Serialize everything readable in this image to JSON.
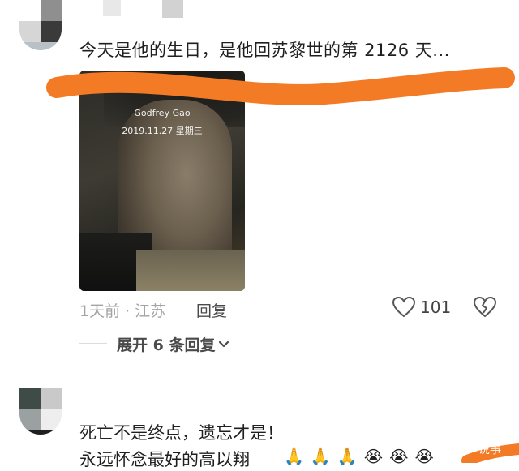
{
  "comment1": {
    "text": "今天是他的生日，是他回苏黎世的第 2126 天...",
    "photo": {
      "name": "Godfrey Gao",
      "date": "2019.11.27  星期三"
    },
    "time_location": "1天前 · 江苏",
    "reply_label": "回复",
    "like_count": "101",
    "expand_replies": "展开 6 条回复"
  },
  "comment2": {
    "line1": "死亡不是终点，遗忘才是！",
    "line2": "永远怀念最好的高以翔",
    "emoji": "🙏🙏🙏😭😭😭"
  },
  "watermark": "说事",
  "icons": {
    "like": "heart-outline-icon",
    "dislike": "broken-heart-icon",
    "expand": "chevron-down-icon"
  },
  "colors": {
    "censor_stroke": "#f47b25",
    "meta_gray": "#a3a3a3"
  }
}
